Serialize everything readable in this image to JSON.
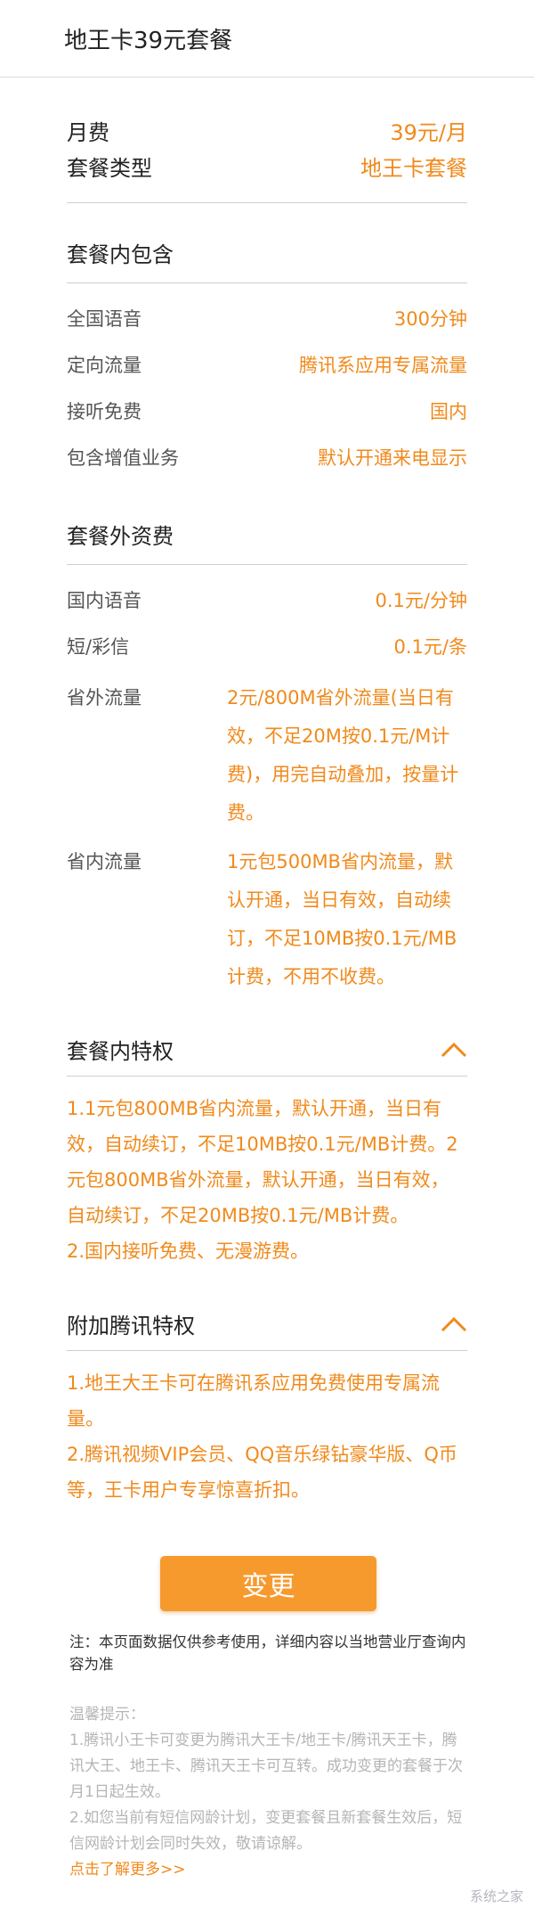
{
  "header": {
    "title": "地王卡39元套餐"
  },
  "basic": {
    "monthly_fee_label": "月费",
    "monthly_fee_value": "39元/月",
    "plan_type_label": "套餐类型",
    "plan_type_value": "地王卡套餐"
  },
  "included": {
    "title": "套餐内包含",
    "items": [
      {
        "label": "全国语音",
        "value": "300分钟"
      },
      {
        "label": "定向流量",
        "value": "腾讯系应用专属流量"
      },
      {
        "label": "接听免费",
        "value": "国内"
      },
      {
        "label": "包含增值业务",
        "value": "默认开通来电显示"
      }
    ]
  },
  "extra_fees": {
    "title": "套餐外资费",
    "items": [
      {
        "label": "国内语音",
        "value": "0.1元/分钟"
      },
      {
        "label": "短/彩信",
        "value": "0.1元/条"
      },
      {
        "label": "省外流量",
        "value": "2元/800M省外流量(当日有效，不足20M按0.1元/M计费)，用完自动叠加，按量计费。"
      },
      {
        "label": "省内流量",
        "value": "1元包500MB省内流量，默认开通，当日有效，自动续订，不足10MB按0.1元/MB计费，不用不收费。"
      }
    ]
  },
  "privileges": {
    "title": "套餐内特权",
    "text1": "1.1元包800MB省内流量，默认开通，当日有效，自动续订，不足10MB按0.1元/MB计费。2元包800MB省外流量，默认开通，当日有效，自动续订，不足20MB按0.1元/MB计费。",
    "text2": "2.国内接听免费、无漫游费。"
  },
  "tencent": {
    "title": "附加腾讯特权",
    "text1": "1.地王大王卡可在腾讯系应用免费使用专属流量。",
    "text2": "2.腾讯视频VIP会员、QQ音乐绿钻豪华版、Q币等，王卡用户专享惊喜折扣。"
  },
  "button": {
    "label": "变更"
  },
  "note": {
    "text": "注：本页面数据仅供参考使用，详细内容以当地营业厅查询内容为准"
  },
  "tips": {
    "title": "温馨提示：",
    "line1": "1.腾讯小王卡可变更为腾讯大王卡/地王卡/腾讯天王卡，腾讯大王、地王卡、腾讯天王卡可互转。成功变更的套餐于次月1日起生效。",
    "line2": "2.如您当前有短信网龄计划，变更套餐且新套餐生效后，短信网龄计划会同时失效，敬请谅解。",
    "link": "点击了解更多>>"
  },
  "watermark": {
    "text": "系统之家"
  },
  "colors": {
    "accent": "#f08a1c",
    "button": "#f79a2e",
    "divider": "#cfcfcf"
  },
  "icons": {
    "collapse": "chevron-up-icon"
  }
}
